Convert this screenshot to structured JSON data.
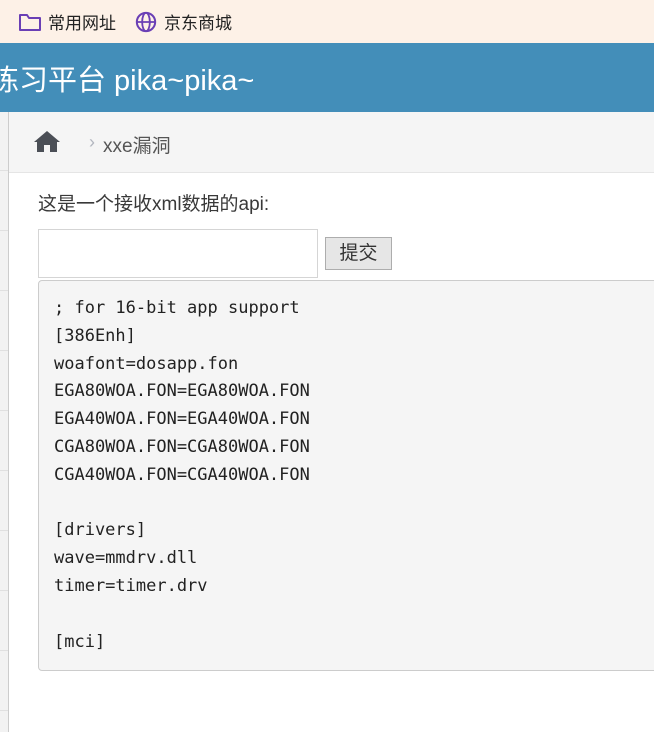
{
  "bookmarks": [
    {
      "label": "常用网址",
      "icon": "folder-icon"
    },
    {
      "label": "京东商城",
      "icon": "globe-icon"
    }
  ],
  "header": {
    "brand": "练习平台 pika~pika~"
  },
  "breadcrumb": {
    "home_icon": "home-icon",
    "separator": "›",
    "current": "xxe漏洞"
  },
  "main": {
    "intro": "这是一个接收xml数据的api:",
    "input_value": "",
    "submit_label": "提交",
    "output_lines": [
      "; for 16-bit app support",
      "[386Enh]",
      "woafont=dosapp.fon",
      "EGA80WOA.FON=EGA80WOA.FON",
      "EGA40WOA.FON=EGA40WOA.FON",
      "CGA80WOA.FON=CGA80WOA.FON",
      "CGA40WOA.FON=CGA40WOA.FON",
      "",
      "[drivers]",
      "wave=mmdrv.dll",
      "timer=timer.drv",
      "",
      "[mci]"
    ]
  },
  "colors": {
    "header_bg": "#438eb9",
    "bookmarks_bg": "#fdf1e7",
    "breadcrumb_bg": "#f5f5f5",
    "icon_purple": "#6a3fb5"
  }
}
